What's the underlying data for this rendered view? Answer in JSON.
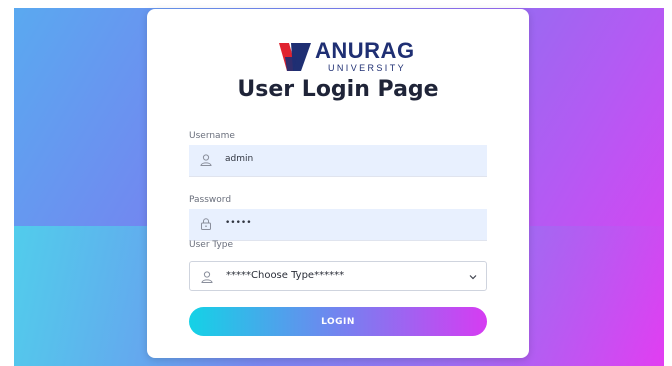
{
  "brand": {
    "name": "ANURAG",
    "subtitle": "UNIVERSITY"
  },
  "page_title": "User Login Page",
  "form": {
    "username": {
      "label": "Username",
      "value": "admin",
      "icon": "user-icon"
    },
    "password": {
      "label": "Password",
      "value": "•••••",
      "icon": "lock-icon"
    },
    "user_type": {
      "label": "User Type",
      "selected": "*****Choose Type******",
      "icon": "user-icon"
    },
    "login_label": "LOGIN"
  },
  "colors": {
    "brand_navy": "#1f2f73",
    "brand_red": "#e0232f",
    "gradient_start": "#14d2e6",
    "gradient_end": "#d63cf2",
    "field_bg": "#e8f0fe"
  }
}
